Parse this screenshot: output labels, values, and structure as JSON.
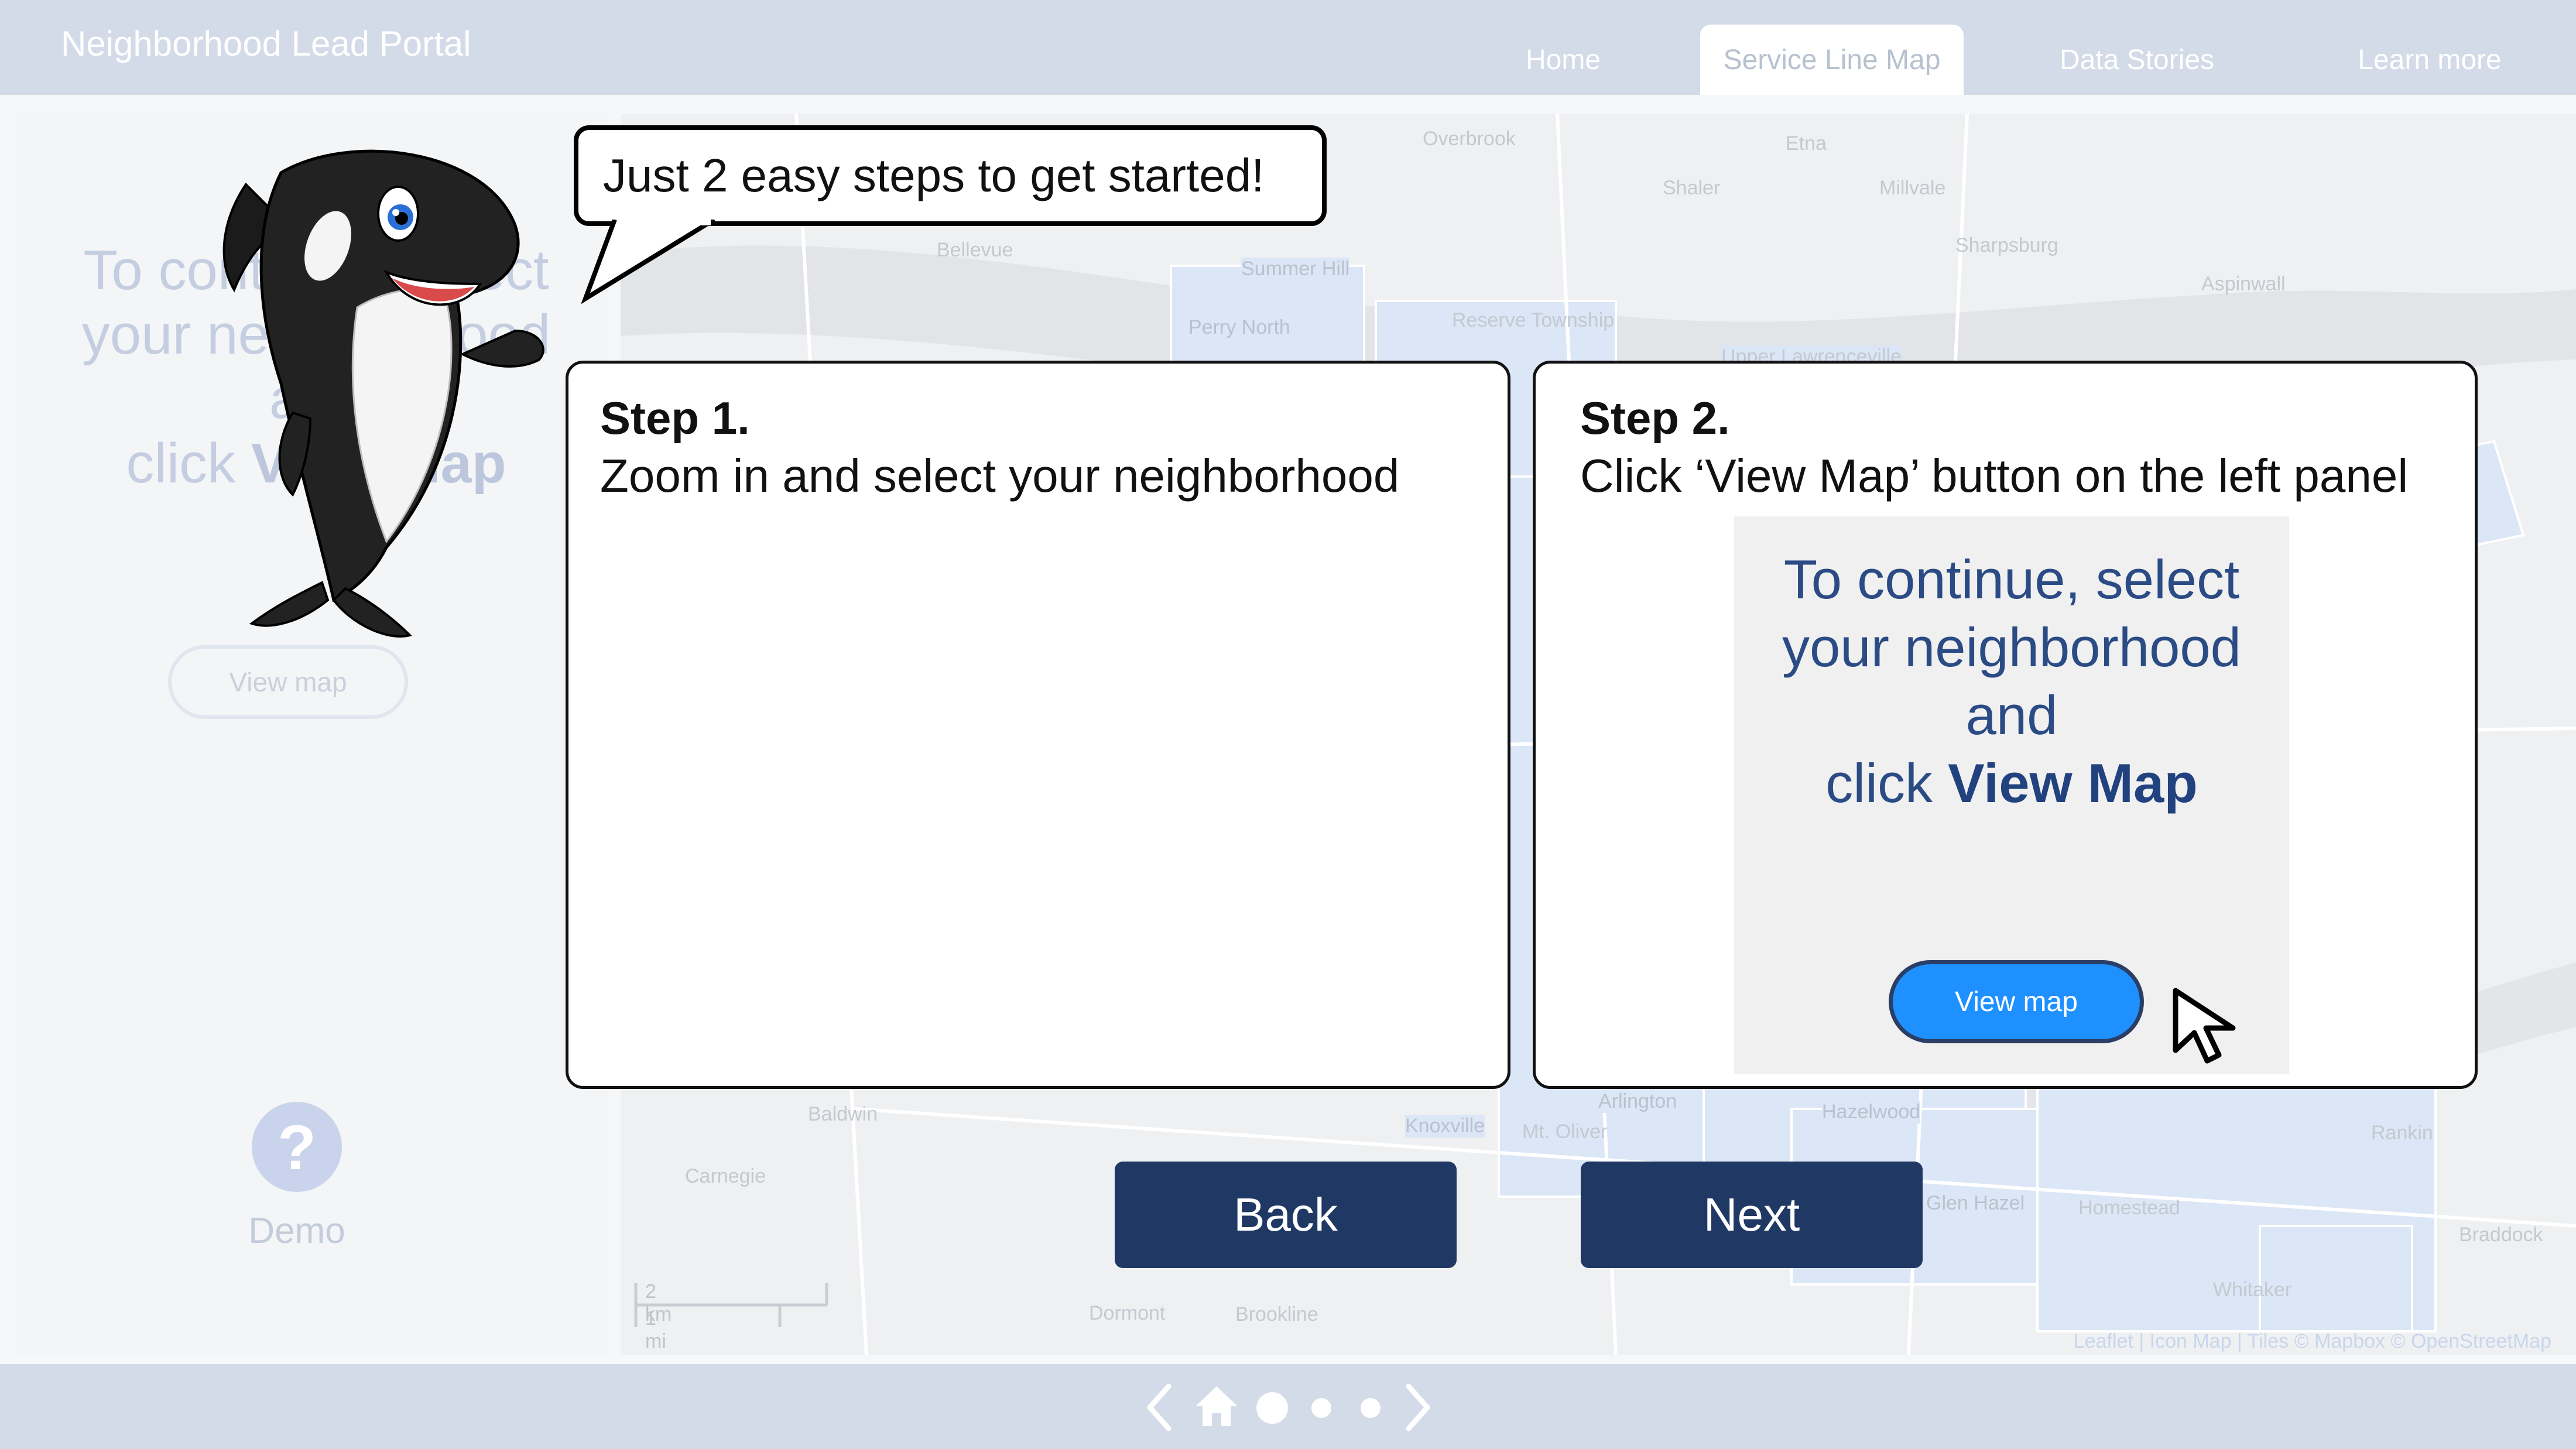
{
  "app": {
    "title": "Neighborhood Lead Portal"
  },
  "nav": {
    "tabs": [
      {
        "label": "Home",
        "active": false
      },
      {
        "label": "Service Line Map",
        "active": true
      },
      {
        "label": "Data Stories",
        "active": false
      },
      {
        "label": "Learn more",
        "active": false
      }
    ]
  },
  "left_panel": {
    "prompt_line1": "To continue, select",
    "prompt_line2": "your neighborhood",
    "prompt_line3": "and",
    "prompt_line4_prefix": "click ",
    "prompt_line4_bold": "View Map",
    "view_map_button": "View map",
    "demo_icon": "question-icon",
    "demo_label": "Demo"
  },
  "map": {
    "labels": [
      "Summer Hill",
      "Perry North",
      "Knoxville",
      "Arlington",
      "Hazelwood",
      "Glen Hazel",
      "Bellevue",
      "Shaler",
      "Reserve Township",
      "Sharpsburg",
      "Aspinwall",
      "Upper Lawrenceville",
      "Etna",
      "Carnegie",
      "Mt. Oliver",
      "Homestead",
      "Rankin",
      "Whitaker",
      "Braddock",
      "Dormont",
      "Brookline",
      "Baldwin",
      "Millvale",
      "Overbrook"
    ],
    "scale_km": "2 km",
    "scale_mi": "1 mi",
    "attribution": "Leaflet | Icon Map | Tiles © Mapbox © OpenStreetMap"
  },
  "tutorial": {
    "bubble": "Just 2 easy steps to get started!",
    "step1": {
      "title": "Step 1.",
      "desc": "Zoom in and select your neighborhood"
    },
    "step2": {
      "title": "Step 2.",
      "desc": "Click ‘View Map’ button on the left panel"
    },
    "preview": {
      "line1": "To continue, select",
      "line2": "your neighborhood",
      "line3": "and",
      "line4_prefix": "click ",
      "line4_bold": "View Map",
      "button": "View map"
    },
    "back_button": "Back",
    "next_button": "Next"
  },
  "pager": {
    "prev_icon": "chevron-left-icon",
    "home_icon": "home-icon",
    "next_icon": "chevron-right-icon",
    "total_dots": 3,
    "active_dot": 1
  },
  "colors": {
    "nav_bg": "#d3dbe8",
    "button_dark": "#1f3864",
    "preview_button": "#1e90ff",
    "preview_text": "#2b4b85"
  }
}
